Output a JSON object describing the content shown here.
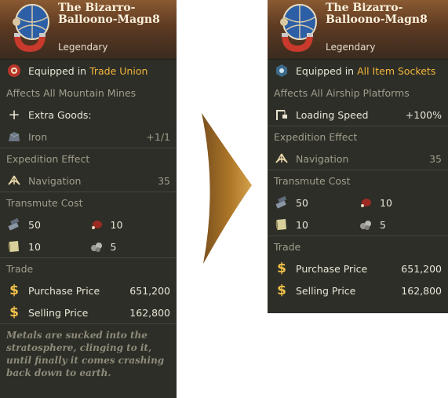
{
  "left": {
    "title": "The Bizarro-Balloono-Magn8",
    "rarity": "Legendary",
    "equipped_prefix": "Equipped in",
    "equipped_where": "Trade Union",
    "affects": "Affects All Mountain Mines",
    "extra_goods_label": "Extra Goods:",
    "extra_item_name": "Iron",
    "extra_item_value": "+1/1",
    "expedition_heading": "Expedition Effect",
    "expedition_name": "Navigation",
    "expedition_value": "35",
    "transmute_heading": "Transmute Cost",
    "transmute": [
      {
        "icon": "steel-icon",
        "amount": "50"
      },
      {
        "icon": "meat-icon",
        "amount": "10"
      },
      {
        "icon": "paper-icon",
        "amount": "10"
      },
      {
        "icon": "stone-icon",
        "amount": "5"
      }
    ],
    "trade_heading": "Trade",
    "purchase_label": "Purchase Price",
    "purchase_value": "651,200",
    "selling_label": "Selling Price",
    "selling_value": "162,800",
    "flavor": "Metals are sucked into the stratosphere, clinging to it, until finally it comes crashing back down to earth."
  },
  "right": {
    "title": "The Bizarro-Balloono-Magn8",
    "rarity": "Legendary",
    "equipped_prefix": "Equipped in",
    "equipped_where": "All Item Sockets",
    "affects": "Affects All Airship Platforms",
    "effect_label": "Loading Speed",
    "effect_value": "+100%",
    "expedition_heading": "Expedition Effect",
    "expedition_name": "Navigation",
    "expedition_value": "35",
    "transmute_heading": "Transmute Cost",
    "transmute": [
      {
        "icon": "steel-icon",
        "amount": "50"
      },
      {
        "icon": "meat-icon",
        "amount": "10"
      },
      {
        "icon": "paper-icon",
        "amount": "10"
      },
      {
        "icon": "stone-icon",
        "amount": "5"
      }
    ],
    "trade_heading": "Trade",
    "purchase_label": "Purchase Price",
    "purchase_value": "651,200",
    "selling_label": "Selling Price",
    "selling_value": "162,800"
  },
  "colors": {
    "panel": "#2d2e27",
    "highlight": "#f3b53a",
    "arrow": "#b07a2a"
  }
}
